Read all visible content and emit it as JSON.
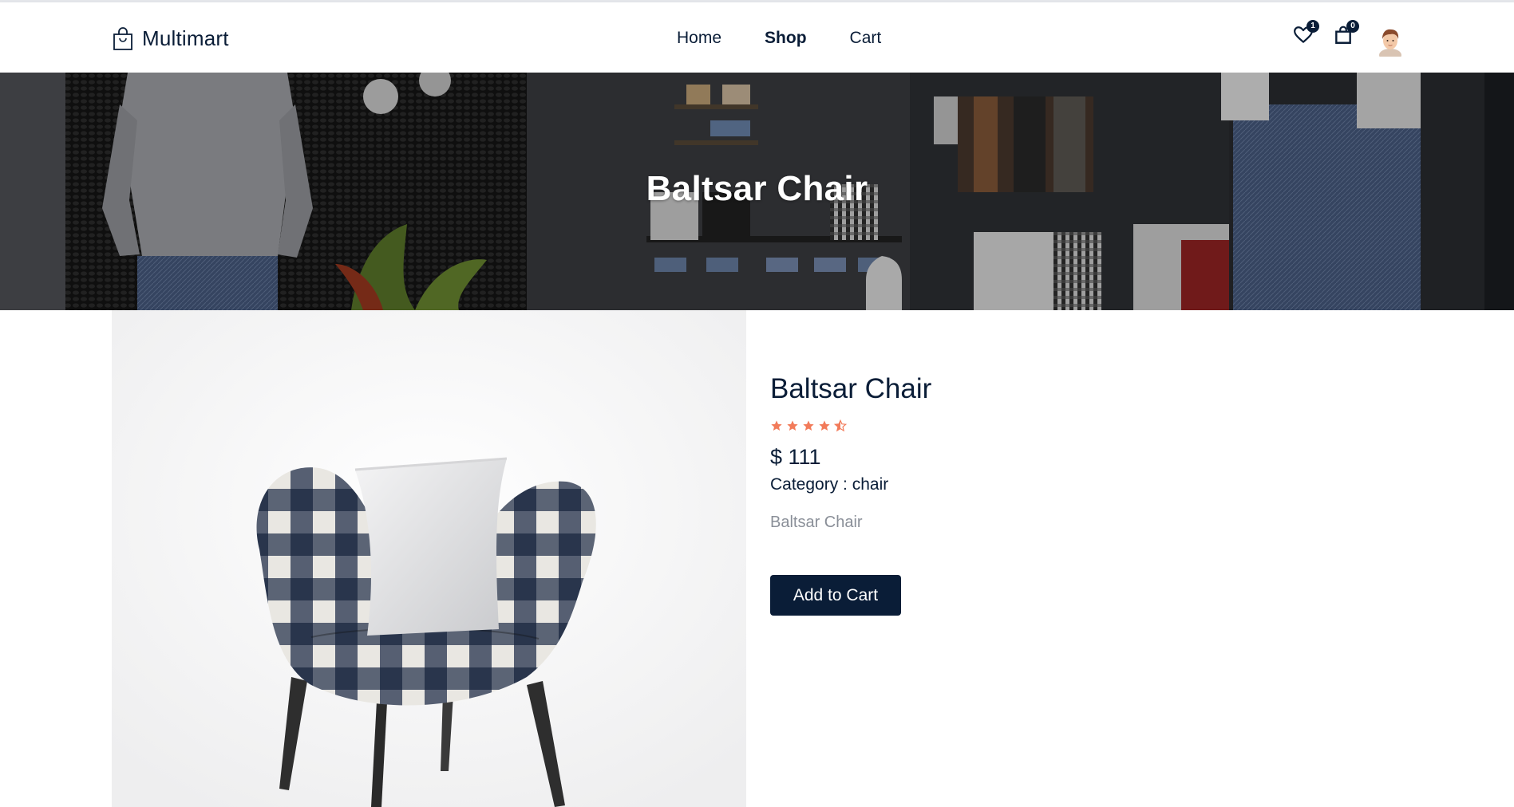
{
  "header": {
    "brand": "Multimart",
    "brand_icon": "shopping-bag-icon",
    "nav": [
      {
        "label": "Home",
        "active": false
      },
      {
        "label": "Shop",
        "active": true
      },
      {
        "label": "Cart",
        "active": false
      }
    ],
    "wishlist_count": "1",
    "cart_count": "0",
    "icons": [
      "heart-icon",
      "shopping-bag-icon",
      "user-avatar"
    ]
  },
  "hero": {
    "title": "Baltsar Chair"
  },
  "product": {
    "name": "Baltsar Chair",
    "rating": 4.5,
    "price": "$ 111",
    "category": "Category : chair",
    "description": "Baltsar Chair",
    "add_to_cart_label": "Add to Cart"
  },
  "colors": {
    "primary": "#0a1d37",
    "star": "#f27b5a",
    "muted_text": "#8a8f98"
  }
}
